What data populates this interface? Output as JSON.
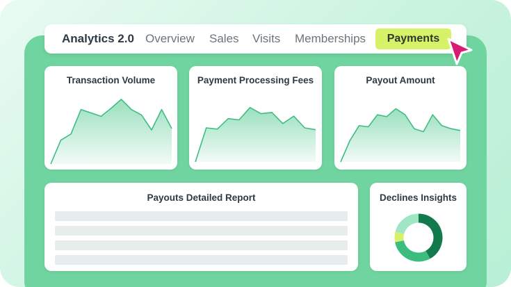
{
  "colors": {
    "stage": "#6fd49f",
    "accent": "#d7f169",
    "chart_stroke": "#3fbd83",
    "chart_fill": "#8fdcb6",
    "donut_dark": "#127a4d",
    "donut_mid": "#3bbd7e",
    "donut_light": "#9fe6c4",
    "donut_yellow": "#d7f169",
    "cursor": "#d81b73"
  },
  "nav": {
    "brand": "Analytics 2.0",
    "items": [
      "Overview",
      "Sales",
      "Visits",
      "Memberships"
    ],
    "active": "Payments",
    "cursor_icon": "pointer-arrow-icon"
  },
  "cards": {
    "transaction_volume": {
      "title": "Transaction Volume"
    },
    "processing_fees": {
      "title": "Payment Processing Fees"
    },
    "payout_amount": {
      "title": "Payout Amount"
    },
    "payouts_report": {
      "title": "Payouts Detailed Report",
      "placeholder_rows": 4
    },
    "declines": {
      "title": "Declines Insights"
    }
  },
  "chart_data": [
    {
      "type": "area",
      "title": "Transaction Volume",
      "x": [
        0,
        1,
        2,
        3,
        4,
        5,
        6,
        7,
        8,
        9,
        10,
        11,
        12
      ],
      "values": [
        0,
        35,
        44,
        80,
        75,
        70,
        82,
        95,
        80,
        72,
        50,
        80,
        52
      ]
    },
    {
      "type": "area",
      "title": "Payment Processing Fees",
      "x": [
        0,
        1,
        2,
        3,
        4,
        5,
        6,
        7,
        8,
        9,
        10,
        11
      ],
      "values": [
        0,
        55,
        53,
        70,
        68,
        88,
        78,
        80,
        62,
        74,
        55,
        52
      ]
    },
    {
      "type": "area",
      "title": "Payout Amount",
      "x": [
        0,
        1,
        2,
        3,
        4,
        5,
        6,
        7,
        8,
        9,
        10,
        11,
        12,
        13
      ],
      "values": [
        0,
        35,
        60,
        58,
        78,
        75,
        88,
        78,
        55,
        50,
        78,
        60,
        55,
        52
      ]
    },
    {
      "type": "pie",
      "title": "Declines Insights",
      "values": [
        42,
        30,
        7,
        21
      ]
    }
  ]
}
